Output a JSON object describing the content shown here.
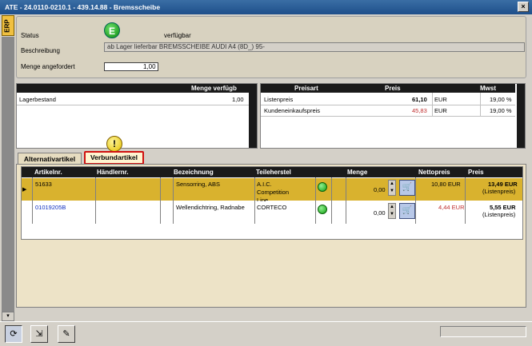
{
  "window": {
    "title": "ATE - 24.0110-0210.1 - 439.14.88 - Bremsscheibe"
  },
  "side_tab": {
    "label": "ERP"
  },
  "left_scroll_arrow": "▾",
  "info": {
    "status_label": "Status",
    "status_badge": "E",
    "status_text": "verfügbar",
    "description_label": "Beschreibung",
    "description_value": "ab Lager lieferbar BREMSSCHEIBE AUDI A4 (8D_)    95-",
    "quantity_label": "Menge angefordert",
    "quantity_value": "1,00"
  },
  "stock_table": {
    "headers": [
      "",
      "Menge verfügb"
    ],
    "rows": [
      {
        "name": "Lagerbestand",
        "qty": "1,00"
      }
    ]
  },
  "price_table": {
    "headers": [
      "Preisart",
      "Preis",
      "",
      "Mwst"
    ],
    "rows": [
      {
        "type": "Listenpreis",
        "price": "61,10",
        "cur": "EUR",
        "vat": "19,00 %"
      },
      {
        "type": "Kundeneinkaufspreis",
        "price": "45,83",
        "cur": "EUR",
        "vat": "19,00 %"
      }
    ]
  },
  "warning_icon": "!",
  "tabs": [
    {
      "label": "Alternativartikel"
    },
    {
      "label": "Verbundartikel"
    }
  ],
  "articles": {
    "headers": {
      "artnr": "Artikelnr.",
      "dealer": "Händlernr.",
      "desc": "Bezeichnung",
      "maker": "Teileherstel",
      "qty": "Menge",
      "net": "Nettopreis",
      "price": "Preis"
    },
    "rows": [
      {
        "artnr": "51633",
        "dealer": "",
        "desc": "Sensorring, ABS",
        "maker": "A.I.C. Competition Line",
        "qty": "0,00",
        "net": "10,80 EUR",
        "price": "13,49 EUR",
        "price_note": "(Listenpreis)"
      },
      {
        "artnr": "01019205B",
        "dealer": "",
        "desc": "Wellendichtring, Radnabe",
        "maker": "CORTECO",
        "qty": "0,00",
        "net": "4,44 EUR",
        "price": "5,55 EUR",
        "price_note": "(Listenpreis)"
      }
    ]
  },
  "colors": {
    "highlight_row": "#d9b22e",
    "net_price_red": "#c03030",
    "artnr_blue": "#1030c0"
  }
}
